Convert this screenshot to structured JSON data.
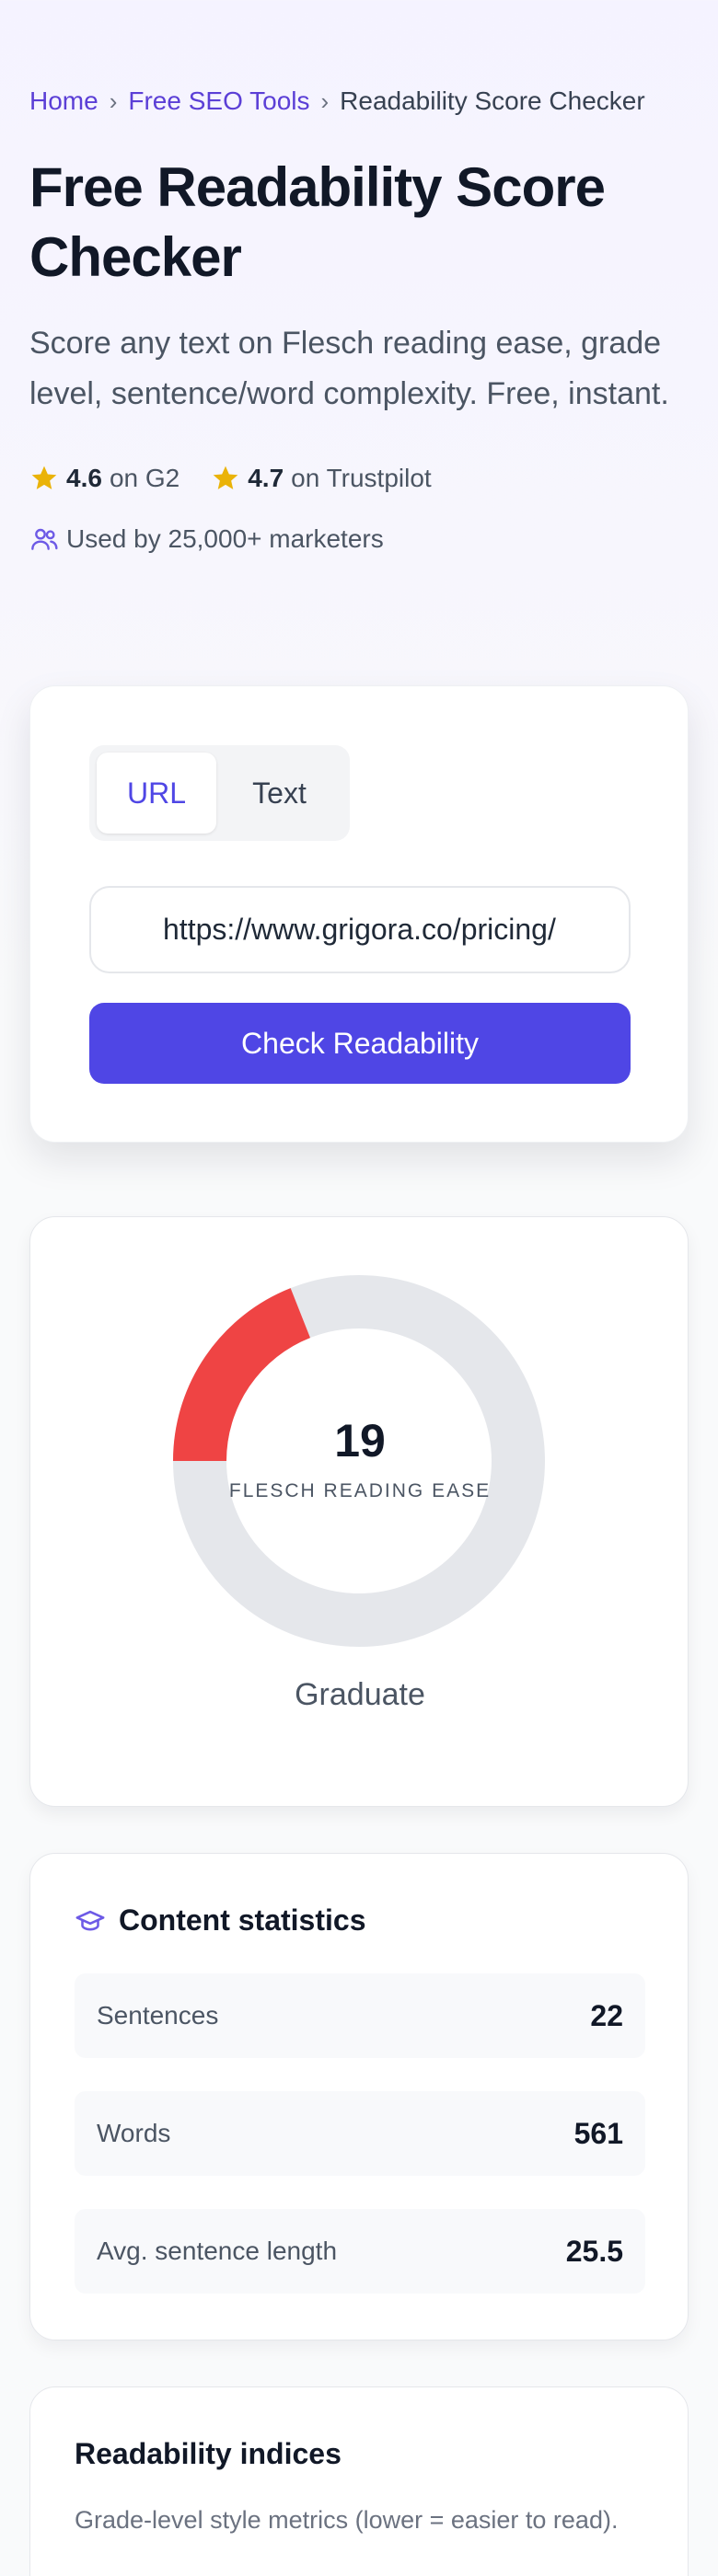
{
  "breadcrumb": {
    "home": "Home",
    "tools": "Free SEO Tools",
    "current": "Readability Score Checker",
    "separator": "›"
  },
  "hero": {
    "title": "Free Readability Score Checker",
    "subtitle": "Score any text on Flesch reading ease, grade level, sentence/word complexity. Free, instant."
  },
  "ratings": [
    {
      "score": "4.6",
      "source": "on G2",
      "icon": "star-icon"
    },
    {
      "score": "4.7",
      "source": "on Trustpilot",
      "icon": "star-icon"
    }
  ],
  "usage": {
    "text": "Used by 25,000+ marketers",
    "icon": "users-icon"
  },
  "form": {
    "tabs": [
      {
        "label": "URL",
        "active": true
      },
      {
        "label": "Text",
        "active": false
      }
    ],
    "url_value": "https://www.grigora.co/pricing/",
    "submit_label": "Check Readability"
  },
  "score": {
    "value": 19,
    "max": 100,
    "label": "FLESCH READING EASE",
    "grade": "Graduate"
  },
  "stats": {
    "title": "Content statistics",
    "icon": "graduation-cap-icon",
    "rows": [
      {
        "label": "Sentences",
        "value": "22"
      },
      {
        "label": "Words",
        "value": "561"
      },
      {
        "label": "Avg. sentence length",
        "value": "25.5"
      }
    ]
  },
  "indices": {
    "title": "Readability indices",
    "description": "Grade-level style metrics (lower = easier to read)."
  },
  "colors": {
    "accent": "#4f46e5",
    "link": "#5b3fd6",
    "star": "#eab308",
    "score_arc": "#ef4444",
    "track": "#e5e7eb"
  }
}
